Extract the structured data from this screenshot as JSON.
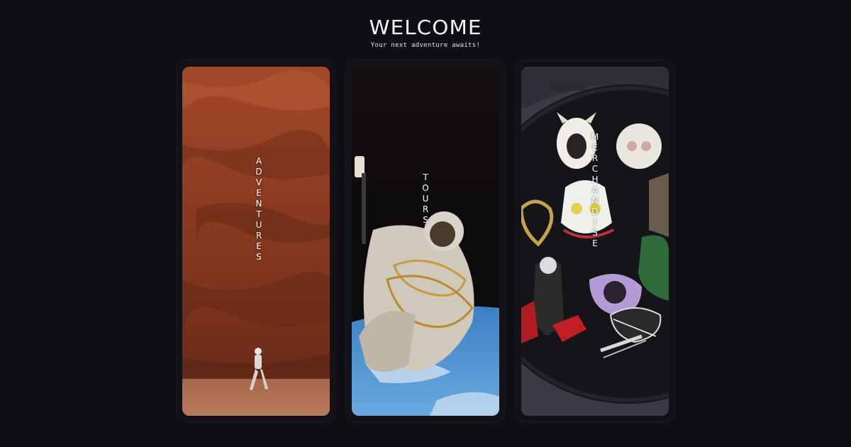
{
  "header": {
    "title": "WELCOME",
    "subtitle": "Your next adventure awaits!"
  },
  "cards": [
    {
      "label": "ADVENTURES",
      "image": "astronaut-on-red-rock-planet"
    },
    {
      "label": "TOURS",
      "image": "astronaut-spacewalk-over-earth"
    },
    {
      "label": "MERCHANDISE",
      "image": "enamel-pins-on-black-hoop"
    }
  ],
  "colors": {
    "background": "#0f0e14",
    "text": "#ffffff"
  }
}
